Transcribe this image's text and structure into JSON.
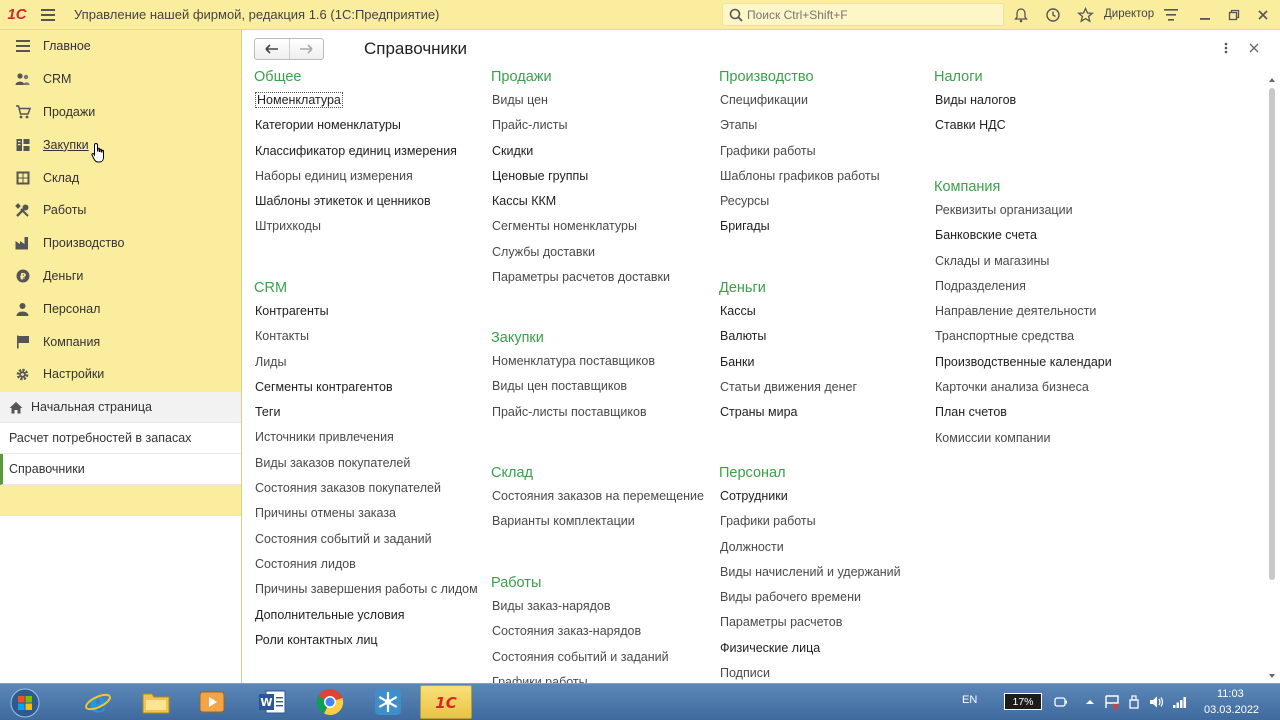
{
  "titlebar": {
    "logo": "1С",
    "title": "Управление нашей фирмой, редакция 1.6  (1С:Предприятие)",
    "search_placeholder": "Поиск Ctrl+Shift+F",
    "user": "Директор"
  },
  "sidebar": {
    "items": [
      {
        "label": "Главное",
        "icon": "menu-lines-icon"
      },
      {
        "label": "CRM",
        "icon": "crm-icon"
      },
      {
        "label": "Продажи",
        "icon": "sales-icon"
      },
      {
        "label": "Закупки",
        "icon": "purchases-icon"
      },
      {
        "label": "Склад",
        "icon": "warehouse-icon"
      },
      {
        "label": "Работы",
        "icon": "tools-icon"
      },
      {
        "label": "Производство",
        "icon": "factory-icon"
      },
      {
        "label": "Деньги",
        "icon": "money-icon"
      },
      {
        "label": "Персонал",
        "icon": "people-icon"
      },
      {
        "label": "Компания",
        "icon": "flag-icon"
      },
      {
        "label": "Настройки",
        "icon": "gear-icon"
      }
    ],
    "open_windows": [
      {
        "label": "Начальная страница"
      },
      {
        "label": "Расчет потребностей в запасах"
      },
      {
        "label": "Справочники"
      }
    ]
  },
  "main": {
    "title": "Справочники",
    "groups": {
      "general": {
        "title": "Общее",
        "links": [
          "Номенклатура",
          "Категории номенклатуры",
          "Классификатор единиц измерения",
          "Наборы единиц измерения",
          "Шаблоны этикеток и ценников",
          "Штрихкоды"
        ]
      },
      "crm": {
        "title": "CRM",
        "links": [
          "Контрагенты",
          "Контакты",
          "Лиды",
          "Сегменты контрагентов",
          "Теги",
          "Источники привлечения",
          "Виды заказов покупателей",
          "Состояния заказов покупателей",
          "Причины отмены заказа",
          "Состояния событий и заданий",
          "Состояния лидов",
          "Причины завершения работы с лидом",
          "Дополнительные условия",
          "Роли контактных лиц"
        ]
      },
      "sales": {
        "title": "Продажи",
        "links": [
          "Виды цен",
          "Прайс-листы",
          "Скидки",
          "Ценовые группы",
          "Кассы ККМ",
          "Сегменты номенклатуры",
          "Службы доставки",
          "Параметры расчетов доставки"
        ]
      },
      "purchases": {
        "title": "Закупки",
        "links": [
          "Номенклатура поставщиков",
          "Виды цен поставщиков",
          "Прайс-листы поставщиков"
        ]
      },
      "warehouse": {
        "title": "Склад",
        "links": [
          "Состояния заказов на перемещение",
          "Варианты комплектации"
        ]
      },
      "works": {
        "title": "Работы",
        "links": [
          "Виды заказ-нарядов",
          "Состояния заказ-нарядов",
          "Состояния событий и заданий",
          "Графики работы"
        ]
      },
      "production": {
        "title": "Производство",
        "links": [
          "Спецификации",
          "Этапы",
          "Графики работы",
          "Шаблоны графиков работы",
          "Ресурсы",
          "Бригады"
        ]
      },
      "money": {
        "title": "Деньги",
        "links": [
          "Кассы",
          "Валюты",
          "Банки",
          "Статьи движения денег",
          "Страны мира"
        ]
      },
      "personnel": {
        "title": "Персонал",
        "links": [
          "Сотрудники",
          "Графики работы",
          "Должности",
          "Виды начислений и удержаний",
          "Виды рабочего времени",
          "Параметры расчетов",
          "Физические лица",
          "Подписи"
        ]
      },
      "taxes": {
        "title": "Налоги",
        "links": [
          "Виды налогов",
          "Ставки НДС"
        ]
      },
      "company": {
        "title": "Компания",
        "links": [
          "Реквизиты организации",
          "Банковские счета",
          "Склады и магазины",
          "Подразделения",
          "Направление деятельности",
          "Транспортные средства",
          "Производственные календари",
          "Карточки анализа бизнеса",
          "План счетов",
          "Комиссии компании"
        ]
      }
    }
  },
  "taskbar": {
    "lang": "EN",
    "battery": "17%",
    "time": "11:03",
    "date": "03.03.2022"
  }
}
